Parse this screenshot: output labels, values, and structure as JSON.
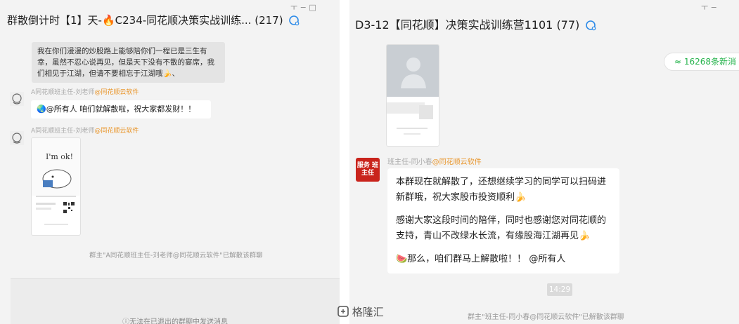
{
  "left": {
    "title": "群散倒计时【1】天-🔥C234-同花顺决策实战训练... (217)",
    "window_controls": "ㅜ  −  □",
    "message1": "我在你们漫漫的炒股路上能够陪你们一程已是三生有幸，虽然不忍心说再见，但是天下没有不散的宴席，我们相见于江湖，但请不要相忘于江湖哦🍌、",
    "sender_name": "A同花顺班主任-刘老师",
    "sender_tag": "@同花顺云软件",
    "message2": "🌏@所有人 咱们就解散啦，祝大家都发财！！",
    "sender2_name": "A同花顺班主任-刘老师",
    "sender2_tag": "@同花顺云软件",
    "card_text": "I'm ok!",
    "system_message": "群主\"A同花顺班主任-刘老师@同花顺云软件\"已解散该群聊",
    "notice": "ⓘ无法在已退出的群聊中发送消息"
  },
  "right": {
    "title": "D3-12【同花顺】决策实战训练营1101 (77)",
    "window_controls": "ㅜ  −",
    "new_messages": "≈ 16268条新消",
    "sender_name": "班主任-同小春",
    "sender_tag": "@同花顺云软件",
    "avatar_text": "服务 班主任",
    "para1": "本群现在就解散了，还想继续学习的同学可以扫码进新群哦，祝大家股市投资顺利🍌",
    "para2": "感谢大家这段时间的陪伴，同时也感谢您对同花顺的支持，青山不改绿水长流，有缘股海江湖再见🍌",
    "para3": "🍉那么，咱们群马上解散啦！！ @所有人",
    "time": "14:29",
    "system_message": "群主\"班主任-同小春@同花顺云软件\"已解散该群聊"
  },
  "watermark": "格隆汇",
  "colors": {
    "panel_bg": "#f3f3f3",
    "bubble_white": "#ffffff",
    "tag_orange": "#e9962c",
    "new_msg_green": "#24b34b",
    "avatar_red": "#c9241c"
  }
}
